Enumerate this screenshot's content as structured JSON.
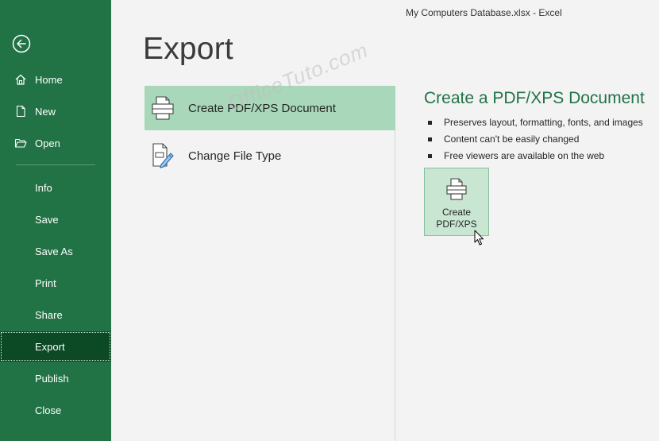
{
  "window": {
    "title": "My Computers Database.xlsx  -  Excel"
  },
  "sidebar": {
    "back_icon": "back-arrow-circle-icon",
    "primary": [
      {
        "label": "Home",
        "icon": "home-icon"
      },
      {
        "label": "New",
        "icon": "new-document-icon"
      },
      {
        "label": "Open",
        "icon": "open-folder-icon"
      }
    ],
    "secondary": [
      {
        "label": "Info"
      },
      {
        "label": "Save"
      },
      {
        "label": "Save As"
      },
      {
        "label": "Print"
      },
      {
        "label": "Share"
      },
      {
        "label": "Export",
        "active": true
      },
      {
        "label": "Publish"
      },
      {
        "label": "Close"
      }
    ]
  },
  "main": {
    "title": "Export",
    "options": [
      {
        "label": "Create PDF/XPS Document",
        "icon": "pdf-document-icon",
        "selected": true
      },
      {
        "label": "Change File Type",
        "icon": "change-file-type-icon",
        "selected": false
      }
    ],
    "details": {
      "title": "Create a PDF/XPS Document",
      "bullets": [
        "Preserves layout, formatting, fonts, and images",
        "Content can't be easily changed",
        "Free viewers are available on the web"
      ],
      "button_line1": "Create",
      "button_line2": "PDF/XPS"
    }
  },
  "watermark": "OfficeTuto.com",
  "colors": {
    "sidebar": "#217346",
    "active_nav": "#0c4a26",
    "accent": "#217346",
    "selected_option": "#a8d8b9",
    "background": "#f3f3f3"
  }
}
